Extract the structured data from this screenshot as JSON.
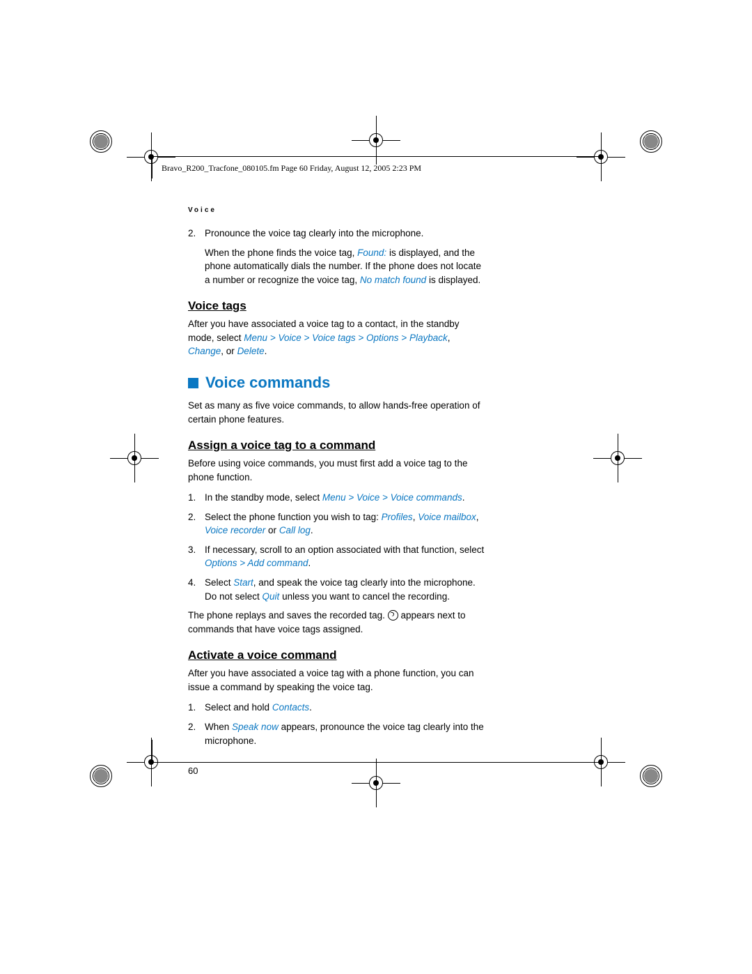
{
  "header": "Bravo_R200_Tracfone_080105.fm  Page 60  Friday, August 12, 2005  2:23 PM",
  "breadcrumb": "Voice",
  "step2": {
    "num": "2.",
    "line1": "Pronounce the voice tag clearly into the microphone.",
    "line2a": "When the phone finds the voice tag, ",
    "found": "Found:",
    "line2b": " is displayed, and the phone automatically dials the number. If the phone does not locate a number or recognize the voice tag, ",
    "nomatch": "No match found",
    "line2c": " is displayed."
  },
  "voicetags": {
    "title": "Voice tags",
    "text": "After you have associated a voice tag to a contact, in the standby mode, select ",
    "path": "Menu > Voice > Voice tags > Options > Playback",
    "comma1": ", ",
    "change": "Change",
    "or": ", or ",
    "delete": "Delete",
    "period": "."
  },
  "voicecmd": {
    "title": "Voice commands",
    "intro": "Set as many as five voice commands, to allow hands-free operation of certain phone features."
  },
  "assign": {
    "title": "Assign a voice tag to a command",
    "intro": "Before using voice commands, you must first add a voice tag to the phone function.",
    "s1": {
      "n": "1.",
      "a": "In the standby mode, select ",
      "k": "Menu > Voice > Voice commands",
      "b": "."
    },
    "s2": {
      "n": "2.",
      "a": "Select the phone function you wish to tag: ",
      "k1": "Profiles",
      "c1": ", ",
      "k2": "Voice mailbox",
      "c2": ", ",
      "k3": "Voice recorder",
      "or": " or ",
      "k4": "Call log",
      "b": "."
    },
    "s3": {
      "n": "3.",
      "a": "If necessary, scroll to an option associated with that function, select ",
      "k": "Options > Add command",
      "b": "."
    },
    "s4": {
      "n": "4.",
      "a": "Select ",
      "k1": "Start",
      "b": ", and speak the voice tag clearly into the microphone. Do not select ",
      "k2": "Quit",
      "c": " unless you want to cancel the recording."
    },
    "tail_a": "The phone replays and saves the recorded tag.  ",
    "tail_b": "  appears next to commands that have voice tags assigned."
  },
  "activate": {
    "title": "Activate a voice command",
    "intro": "After you have associated a voice tag with a phone function, you can issue a command by speaking the voice tag.",
    "s1": {
      "n": "1.",
      "a": "Select and hold ",
      "k": "Contacts",
      "b": "."
    },
    "s2": {
      "n": "2.",
      "a": "When ",
      "k": "Speak now",
      "b": " appears, pronounce the voice tag clearly into the microphone."
    }
  },
  "pagenum": "60"
}
